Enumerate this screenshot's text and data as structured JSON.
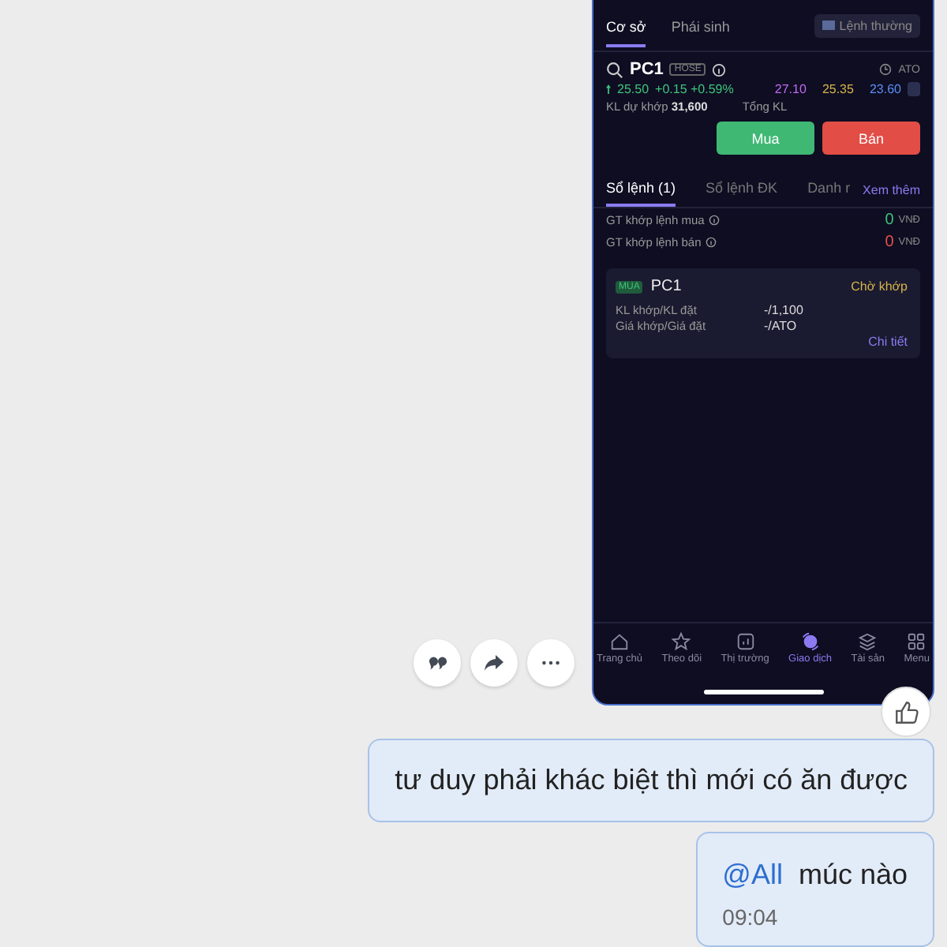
{
  "screenshot": {
    "tabs": [
      {
        "label": "Cơ sở",
        "selected": true
      },
      {
        "label": "Phái sinh",
        "selected": false
      }
    ],
    "order_type": "Lệnh thường",
    "symbol": "PC1",
    "exchange": "HOSE",
    "session": "ATO",
    "price": "25.50",
    "change": "+0.15 +0.59%",
    "ceiling": "27.10",
    "reference": "25.35",
    "floor": "23.60",
    "matched_label": "KL dự khớp",
    "matched_value": "31,600",
    "total_label": "Tổng KL",
    "buy_button": "Mua",
    "sell_button": "Bán",
    "order_tabs": [
      {
        "label": "Sổ lệnh (1)",
        "selected": true
      },
      {
        "label": "Sổ lệnh ĐK",
        "selected": false
      },
      {
        "label": "Danh r",
        "selected": false
      }
    ],
    "more_link": "Xem thêm",
    "summary": [
      {
        "label": "GT khớp lệnh mua",
        "value": "0",
        "unit": "VNĐ",
        "kind": "buy"
      },
      {
        "label": "GT khớp lệnh bán",
        "value": "0",
        "unit": "VNĐ",
        "kind": "sell"
      }
    ],
    "order": {
      "side": "MUA",
      "symbol": "PC1",
      "status": "Chờ khớp",
      "rows": [
        {
          "label": "KL khớp/KL đặt",
          "value": "-/1,100"
        },
        {
          "label": "Giá khớp/Giá đặt",
          "value": "-/ATO"
        }
      ],
      "detail_link": "Chi tiết"
    },
    "nav": [
      {
        "label": "Trang chủ",
        "kind": "home",
        "selected": false
      },
      {
        "label": "Theo dõi",
        "kind": "star",
        "selected": false
      },
      {
        "label": "Thị trường",
        "kind": "chart",
        "selected": false
      },
      {
        "label": "Giao dịch",
        "kind": "trade",
        "selected": true
      },
      {
        "label": "Tài sản",
        "kind": "layers",
        "selected": false
      },
      {
        "label": "Menu",
        "kind": "grid",
        "selected": false
      }
    ]
  },
  "messages": [
    {
      "text": "tư duy phải khác biệt thì mới có ăn được"
    },
    {
      "mention": "@All",
      "text": "múc nào",
      "time": "09:04"
    }
  ]
}
